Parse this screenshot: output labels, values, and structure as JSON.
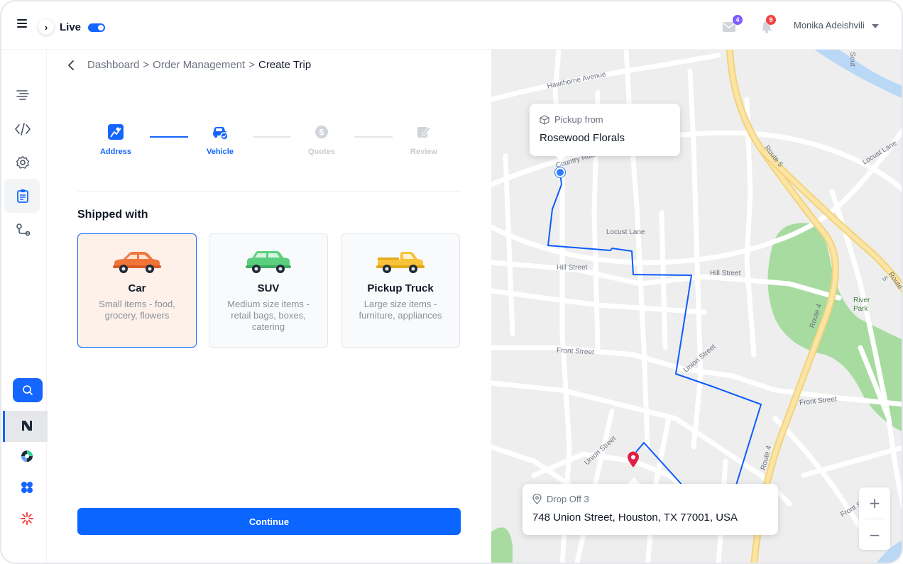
{
  "topbar": {
    "live_label": "Live",
    "live_on": true,
    "mail_badge": "4",
    "bell_badge": "9",
    "user_name": "Monika Adeishvili"
  },
  "breadcrumb": {
    "items": [
      "Dashboard",
      "Order Management"
    ],
    "separator": ">",
    "current": "Create Trip"
  },
  "steps": [
    {
      "label": "Address",
      "state": "done",
      "icon": "map-icon"
    },
    {
      "label": "Vehicle",
      "state": "done",
      "icon": "car-check-icon"
    },
    {
      "label": "Quotes",
      "state": "todo",
      "icon": "dollar-icon"
    },
    {
      "label": "Review",
      "state": "todo",
      "icon": "edit-icon"
    }
  ],
  "shipping": {
    "title": "Shipped with",
    "options": [
      {
        "name": "Car",
        "desc": "Small items - food, grocery, flowers",
        "selected": true,
        "color": "#f0753a"
      },
      {
        "name": "SUV",
        "desc": "Medium size items - retail bags, boxes, catering",
        "selected": false,
        "color": "#5ccf7f"
      },
      {
        "name": "Pickup Truck",
        "desc": "Large size items - furniture, appliances",
        "selected": false,
        "color": "#f8c23a"
      }
    ]
  },
  "actions": {
    "continue_label": "Continue"
  },
  "map": {
    "pickup_title": "Pickup from",
    "pickup_value": "Rosewood Florals",
    "dropoff_title": "Drop Off 3",
    "dropoff_value": "748 Union Street, Houston, TX 77001, USA",
    "streets": {
      "hawthorne": "Hawthorne Avenue",
      "country": "Country Road",
      "locust": "Locust Lane",
      "locust2": "Locust Lane",
      "hill1": "Hill Street",
      "hill2": "Hill Street",
      "front1": "Front Street",
      "front2": "Front Street",
      "front3": "Front Stre",
      "union1": "Union Street",
      "union2": "Union Street",
      "route5": "Route 5",
      "route4a": "Route 4",
      "route4b": "Route 4",
      "south": "Sout",
      "park": "River Park"
    },
    "zoom_in": "+",
    "zoom_out": "−",
    "route_color": "#0b5bff",
    "pin_color": "#e11d48"
  }
}
